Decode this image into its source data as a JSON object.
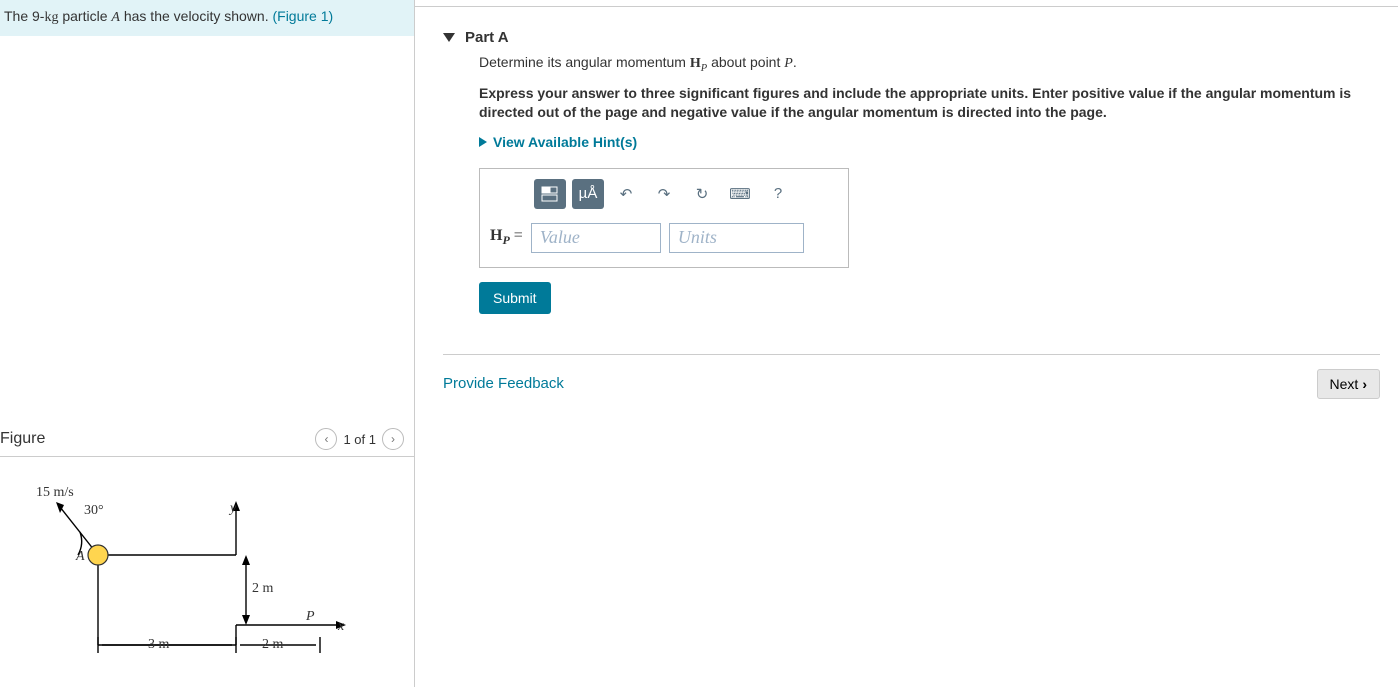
{
  "problem": {
    "prefix": "The 9-",
    "unit": "kg",
    "mid": " particle ",
    "var": "A",
    "suffix": " has the velocity shown. ",
    "figlink": "(Figure 1)"
  },
  "figure": {
    "title": "Figure",
    "pager": "1 of 1",
    "labels": {
      "speed": "15 m/s",
      "angle": "30°",
      "A": "A",
      "y": "y",
      "P": "P",
      "x": "x",
      "d2m_a": "2 m",
      "d3m": "3 m",
      "d2m_b": "2 m"
    }
  },
  "part": {
    "title": "Part A",
    "question_pre": "Determine its angular momentum ",
    "question_sym_main": "H",
    "question_sym_sub": "P",
    "question_mid": " about point ",
    "question_point": "P",
    "question_end": ".",
    "instruction": "Express your answer to three significant figures and include the appropriate units. Enter positive value if the angular momentum is directed out of the page and negative value if the angular momentum is directed into the page.",
    "hints_label": "View Available Hint(s)",
    "toolbar": {
      "units_btn": "µÅ",
      "help": "?"
    },
    "answer": {
      "lhs_main": "H",
      "lhs_sub": "P",
      "lhs_eq": " = ",
      "value_ph": "Value",
      "units_ph": "Units"
    },
    "submit": "Submit"
  },
  "footer": {
    "feedback": "Provide Feedback",
    "next": "Next"
  }
}
